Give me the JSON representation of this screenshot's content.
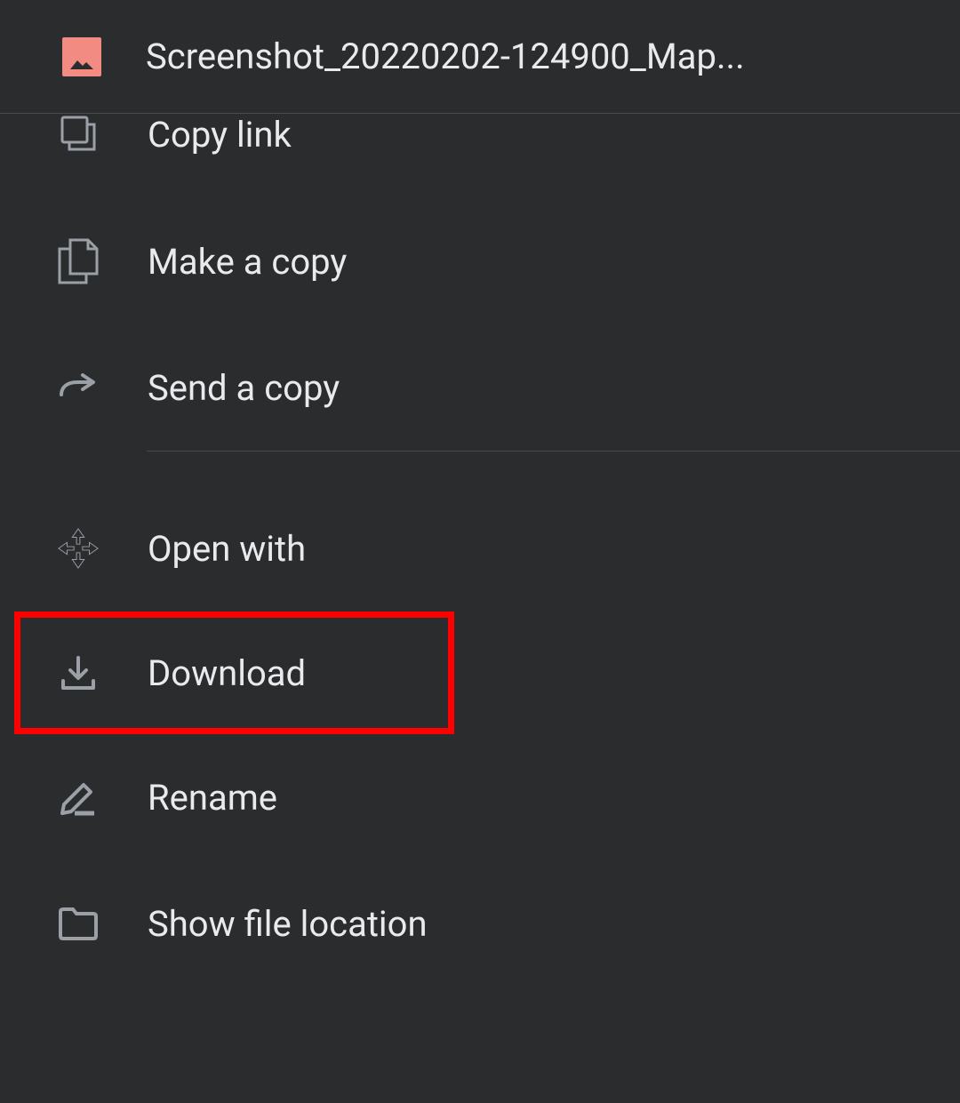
{
  "header": {
    "filename": "Screenshot_20220202-124900_Map..."
  },
  "menu": {
    "copy_link": "Copy link",
    "make_a_copy": "Make a copy",
    "send_a_copy": "Send a copy",
    "open_with": "Open with",
    "download": "Download",
    "rename": "Rename",
    "show_file_location": "Show file location"
  }
}
